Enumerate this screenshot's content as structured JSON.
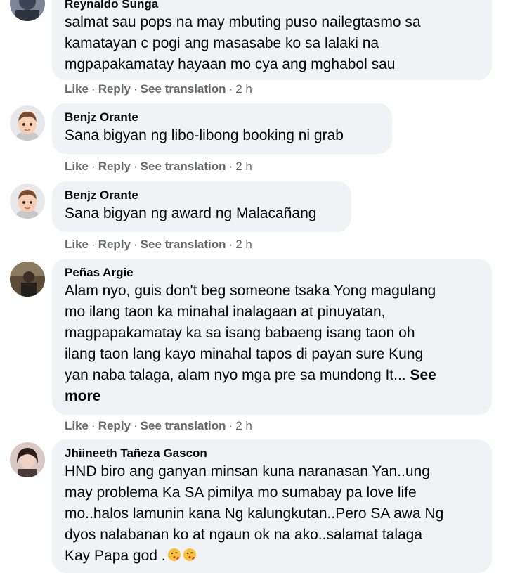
{
  "comments": [
    {
      "author": "Reynaldo Sunga",
      "text": "salmat sau pops na may mbuting puso nailegtasmo sa\nkamatayan c pogi ang masasabe ko sa lalaki na\nmgpapakamatay hayaan mo cya ang mghabol sau",
      "actions": {
        "like": "Like",
        "reply": "Reply",
        "translate": "See translation",
        "time": "2 h"
      }
    },
    {
      "author": "Benjz Orante",
      "text": "Sana bigyan ng libo-libong booking ni grab",
      "actions": {
        "like": "Like",
        "reply": "Reply",
        "translate": "See translation",
        "time": "2 h"
      }
    },
    {
      "author": "Benjz Orante",
      "text": "Sana bigyan ng award ng Malacañang",
      "actions": {
        "like": "Like",
        "reply": "Reply",
        "translate": "See translation",
        "time": "2 h"
      }
    },
    {
      "author": "Peñas Argie",
      "text": "Alam nyo, guis don't beg someone tsaka Yong magulang\nmo ilang taon ka minahal inalagaan at pinuyatan,\nmagpapakamatay ka sa isang babaeng isang taon oh\nilang taon lang kayo minahal tapos di payan sure Kung\nyan naba talaga, alam nyo mga pre sa mundong It...",
      "see_more_1": "See",
      "see_more_2": "more",
      "actions": {
        "like": "Like",
        "reply": "Reply",
        "translate": "See translation",
        "time": "2 h"
      }
    },
    {
      "author": "Jhiineeth Tañeza Gascon",
      "text": "HND biro ang ganyan minsan kuna naranasan Yan..ung\nmay problema Ka SA pimilya mo sumabay pa love life\nmo..halos lamunin kana Ng kalungkutan..Pero SA awa Ng\ndyos nalabanan ko at ngaun ok na ako..salamat talaga\nKay Papa god .",
      "emoji": "face-blowing-kiss-icon"
    }
  ],
  "separator": "·"
}
